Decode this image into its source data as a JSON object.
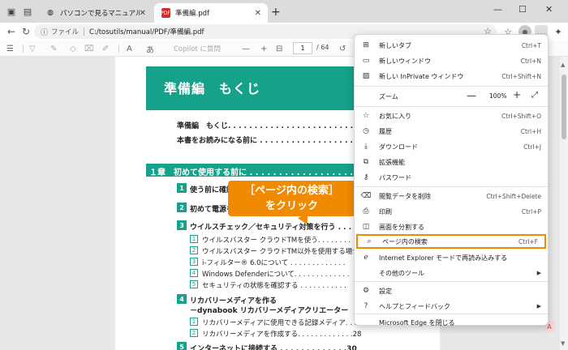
{
  "tabstrip": {
    "inactive_tab_title": "パソコンで見るマニュアル",
    "active_tab_title": "準備編.pdf",
    "pdf_badge": "PDF",
    "close_glyph": "✕",
    "newtab_glyph": "+",
    "minimize_glyph": "—",
    "maximize_glyph": "☐",
    "window_close_glyph": "✕"
  },
  "navbar": {
    "file_label": "ファイル",
    "url": "C:/tosutils/manual/PDF/準備編.pdf"
  },
  "pdf_toolbar": {
    "copilot_placeholder": "Copilot に質問",
    "zoom_minus": "—",
    "zoom_plus": "+",
    "current_page": "1",
    "total_pages": "/ 64"
  },
  "document": {
    "banner_title": "準備編　もくじ",
    "toc_lines": [
      "準備編　もくじ. . . . . . . . . . . . . . . . . . . . . . . . . . .",
      "本書をお読みになる前に . . . . . . . . . . . . . . . . . . . . ."
    ],
    "chapter_title": "１章　初めて使用する前に . . . . . . . . . . . . . . . . . . .",
    "sections": [
      {
        "num": "1",
        "text": "使う前に確認"
      },
      {
        "num": "2",
        "text": "初めて電源を"
      },
      {
        "num": "3",
        "text": "ウイルスチェック／セキュリティ対策を行う . . ."
      },
      {
        "num": "4",
        "text": "リカバリーメディアを作る"
      },
      {
        "num": "5",
        "text": "インターネットに接続する . . . . . . . . . . . . .30"
      }
    ],
    "section4_sub": "－dynabook リカバリーメディアクリエーター",
    "subitems_s3": [
      {
        "num": "1",
        "text": "ウイルスバスター クラウドTMを使う. . . . . . . . . ."
      },
      {
        "num": "2",
        "text": "ウイルスバスター クラウドTM以外を使用する場合"
      },
      {
        "num": "3",
        "text": "i-フィルター® 6.0について . . . . . . . . . . . . ."
      },
      {
        "num": "4",
        "text": "Windows Defenderについて. . . . . . . . . . . . ."
      },
      {
        "num": "5",
        "text": "セキュリティの状態を確認する . . . . . . . . . . ."
      }
    ],
    "subitems_s4": [
      {
        "num": "1",
        "text": "リカバリーメディアに使用できる記録メディア. . . . . ."
      },
      {
        "num": "2",
        "text": "リカバリーメディアを作成する. . . . . . . . . . . . .28"
      }
    ]
  },
  "callout": {
    "line1": "［ページ内の検索］",
    "line2": "をクリック"
  },
  "menu": {
    "items": [
      {
        "label": "新しいタブ",
        "shortcut": "Ctrl+T",
        "icon": "new-tab-icon"
      },
      {
        "label": "新しいウィンドウ",
        "shortcut": "Ctrl+N",
        "icon": "new-window-icon"
      },
      {
        "label": "新しい InPrivate ウィンドウ",
        "shortcut": "Ctrl+Shift+N",
        "icon": "inprivate-icon"
      },
      {
        "label": "お気に入り",
        "shortcut": "Ctrl+Shift+O",
        "icon": "favorites-icon"
      },
      {
        "label": "履歴",
        "shortcut": "Ctrl+H",
        "icon": "history-icon"
      },
      {
        "label": "ダウンロード",
        "shortcut": "Ctrl+J",
        "icon": "download-icon"
      },
      {
        "label": "拡張機能",
        "shortcut": "",
        "icon": "extensions-icon"
      },
      {
        "label": "パスワード",
        "shortcut": "",
        "icon": "key-icon"
      },
      {
        "label": "閲覧データを削除",
        "shortcut": "Ctrl+Shift+Delete",
        "icon": "delete-data-icon"
      },
      {
        "label": "印刷",
        "shortcut": "Ctrl+P",
        "icon": "print-icon"
      },
      {
        "label": "画面を分割する",
        "shortcut": "",
        "icon": "split-screen-icon"
      },
      {
        "label": "ページ内の検索",
        "shortcut": "Ctrl+F",
        "icon": "find-in-page-icon"
      },
      {
        "label": "Internet Explorer モードで再読み込みする",
        "shortcut": "",
        "icon": "ie-mode-icon"
      },
      {
        "label": "その他のツール",
        "shortcut": "",
        "icon": "more-tools-icon"
      },
      {
        "label": "設定",
        "shortcut": "",
        "icon": "settings-icon"
      },
      {
        "label": "ヘルプとフィードバック",
        "shortcut": "",
        "icon": "help-icon"
      },
      {
        "label": "Microsoft Edge を閉じる",
        "shortcut": "",
        "icon": ""
      }
    ],
    "zoom": {
      "label": "ズーム",
      "value": "100%",
      "minus": "—",
      "plus": "+"
    }
  },
  "colors": {
    "accent": "#16a28a",
    "highlight": "#f08a00"
  }
}
